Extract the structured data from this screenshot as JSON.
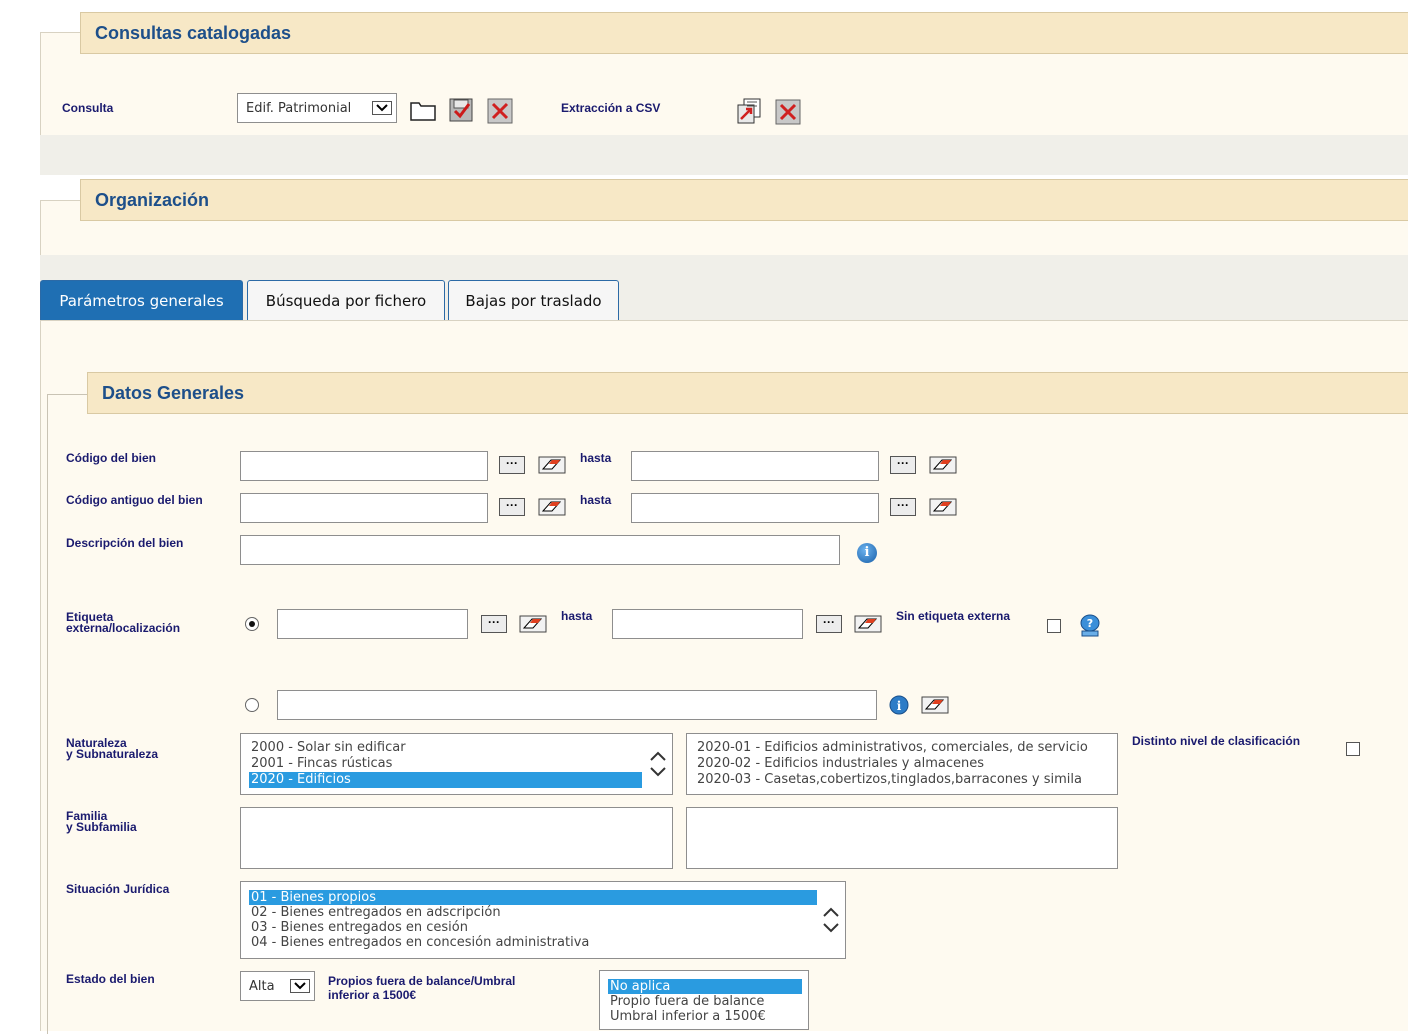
{
  "consultas": {
    "legend": "Consultas catalogadas",
    "consulta_label": "Consulta",
    "consulta_value": "Edif. Patrimonial",
    "extraccion_label": "Extracción a CSV"
  },
  "organizacion": {
    "legend": "Organización"
  },
  "tabs": [
    {
      "label": "Parámetros generales",
      "active": true
    },
    {
      "label": "Búsqueda por fichero",
      "active": false
    },
    {
      "label": "Bajas por traslado",
      "active": false
    }
  ],
  "datos": {
    "legend": "Datos Generales",
    "codigo_bien": "Código del bien",
    "codigo_antiguo": "Código antiguo del bien",
    "descripcion": "Descripción del bien",
    "hasta": "hasta",
    "etiqueta_line1": "Etiqueta",
    "etiqueta_line2": "externa/localización",
    "sin_etiqueta": "Sin etiqueta externa",
    "naturaleza_line1": "Naturaleza",
    "naturaleza_line2": "y Subnaturaleza",
    "distinto_nivel": "Distinto nivel de clasificación",
    "familia_line1": "Familia",
    "familia_line2": "y Subfamilia",
    "situacion": "Situación Jurídica",
    "estado": "Estado del bien",
    "estado_value": "Alta",
    "propios_line1": "Propios fuera de balance/Umbral",
    "propios_line2": "inferior a 1500€"
  },
  "naturaleza_options": [
    {
      "text": "2000 - Solar sin edificar",
      "selected": false
    },
    {
      "text": "2001 - Fincas rústicas",
      "selected": false
    },
    {
      "text": "2020 - Edificios",
      "selected": true
    }
  ],
  "subnaturaleza_options": [
    {
      "text": "2020-01 - Edificios administrativos, comerciales, de servicio",
      "selected": false
    },
    {
      "text": "2020-02 - Edificios industriales y almacenes",
      "selected": false
    },
    {
      "text": "2020-03 - Casetas,cobertizos,tinglados,barracones y simila",
      "selected": false
    }
  ],
  "situacion_options": [
    {
      "text": "01 - Bienes propios",
      "selected": true
    },
    {
      "text": "02 - Bienes entregados en adscripción",
      "selected": false
    },
    {
      "text": "03 - Bienes entregados en cesión",
      "selected": false
    },
    {
      "text": "04 - Bienes entregados en concesión administrativa",
      "selected": false
    }
  ],
  "propios_options": [
    {
      "text": "No aplica",
      "selected": true
    },
    {
      "text": "Propio fuera de balance",
      "selected": false
    },
    {
      "text": "Umbral inferior a 1500€",
      "selected": false
    }
  ],
  "icons": {
    "browse": "ellipsis-icon",
    "clear": "eraser-icon",
    "info": "info-icon",
    "help": "help-icon",
    "folder": "folder-icon",
    "save": "save-query-icon",
    "delete": "delete-icon",
    "csv": "csv-export-icon"
  },
  "colors": {
    "legend_bg": "#f7e8c6",
    "legend_text": "#1d4f8a",
    "tab_active": "#1f6fb3",
    "selection": "#2a9be0",
    "label_text": "#1a1a6e"
  }
}
